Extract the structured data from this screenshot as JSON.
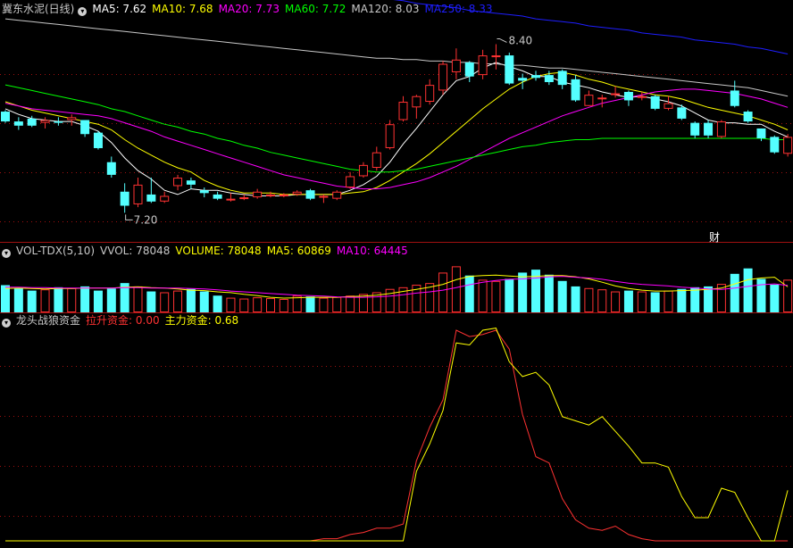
{
  "colors": {
    "background": "#000000",
    "up": "#ff3232",
    "down": "#54ffff",
    "ma5": "#ffffff",
    "ma10": "#ffff00",
    "ma20": "#ff00ff",
    "ma60": "#00ff00",
    "ma120": "#c8c8c8",
    "ma250": "#1e1eff",
    "grid": "#a01010",
    "text": "#c8c8c8"
  },
  "price_panel": {
    "title": "冀东水泥(日线)",
    "indicators": [
      {
        "label": "MA5: 7.62",
        "color": "#ffffff"
      },
      {
        "label": "MA10: 7.68",
        "color": "#ffff00"
      },
      {
        "label": "MA20: 7.73",
        "color": "#ff00ff"
      },
      {
        "label": "MA60: 7.72",
        "color": "#00ff00"
      },
      {
        "label": "MA120: 8.03",
        "color": "#c8c8c8"
      },
      {
        "label": "MA250: 8.33",
        "color": "#1e1eff"
      }
    ],
    "high_label": "8.40",
    "low_label": "7.20",
    "event_marker": "财"
  },
  "volume_panel": {
    "title": "VOL-TDX(5,10)",
    "indicators": [
      {
        "label": "VVOL: 78048",
        "color": "#c8c8c8"
      },
      {
        "label": "VOLUME: 78048",
        "color": "#ffff00"
      },
      {
        "label": "MA5: 60869",
        "color": "#ffff00"
      },
      {
        "label": "MA10: 64445",
        "color": "#ff00ff"
      }
    ]
  },
  "indicator_panel": {
    "title": "龙头战狼资金",
    "indicators": [
      {
        "label": "拉升资金: 0.00",
        "color": "#ff3232"
      },
      {
        "label": "主力资金: 0.68",
        "color": "#ffff00"
      }
    ]
  },
  "chart_data": [
    {
      "type": "candlestick",
      "title": "冀东水泥(日线)",
      "ylim": [
        7.05,
        8.6
      ],
      "candles": [
        [
          7.92,
          7.85,
          7.93,
          7.84
        ],
        [
          7.85,
          7.82,
          7.88,
          7.79
        ],
        [
          7.87,
          7.82,
          7.89,
          7.81
        ],
        [
          7.84,
          7.86,
          7.88,
          7.8
        ],
        [
          7.85,
          7.84,
          7.88,
          7.82
        ],
        [
          7.86,
          7.88,
          7.9,
          7.82
        ],
        [
          7.86,
          7.76,
          7.86,
          7.74
        ],
        [
          7.77,
          7.66,
          7.78,
          7.65
        ],
        [
          7.56,
          7.47,
          7.6,
          7.45
        ],
        [
          7.35,
          7.25,
          7.41,
          7.2
        ],
        [
          7.26,
          7.4,
          7.45,
          7.24
        ],
        [
          7.33,
          7.28,
          7.45,
          7.27
        ],
        [
          7.28,
          7.32,
          7.35,
          7.27
        ],
        [
          7.39,
          7.45,
          7.47,
          7.36
        ],
        [
          7.43,
          7.4,
          7.45,
          7.37
        ],
        [
          7.36,
          7.34,
          7.38,
          7.31
        ],
        [
          7.33,
          7.3,
          7.35,
          7.29
        ],
        [
          7.3,
          7.3,
          7.34,
          7.28
        ],
        [
          7.3,
          7.31,
          7.33,
          7.29
        ],
        [
          7.31,
          7.35,
          7.37,
          7.3
        ],
        [
          7.33,
          7.33,
          7.35,
          7.31
        ],
        [
          7.33,
          7.33,
          7.34,
          7.31
        ],
        [
          7.33,
          7.35,
          7.36,
          7.32
        ],
        [
          7.36,
          7.3,
          7.37,
          7.29
        ],
        [
          7.31,
          7.32,
          7.33,
          7.27
        ],
        [
          7.3,
          7.35,
          7.36,
          7.29
        ],
        [
          7.38,
          7.46,
          7.49,
          7.37
        ],
        [
          7.46,
          7.54,
          7.56,
          7.45
        ],
        [
          7.52,
          7.63,
          7.67,
          7.5
        ],
        [
          7.66,
          7.83,
          7.86,
          7.65
        ],
        [
          7.86,
          7.99,
          8.03,
          7.85
        ],
        [
          7.95,
          8.03,
          8.04,
          7.87
        ],
        [
          7.99,
          8.11,
          8.15,
          7.97
        ],
        [
          8.07,
          8.26,
          8.28,
          8.04
        ],
        [
          8.2,
          8.29,
          8.37,
          8.15
        ],
        [
          8.27,
          8.17,
          8.28,
          8.13
        ],
        [
          8.18,
          8.32,
          8.36,
          8.15
        ],
        [
          8.31,
          8.32,
          8.4,
          8.22
        ],
        [
          8.32,
          8.12,
          8.34,
          8.11
        ],
        [
          8.16,
          8.14,
          8.19,
          8.08
        ],
        [
          8.18,
          8.16,
          8.21,
          8.14
        ],
        [
          8.18,
          8.13,
          8.21,
          8.11
        ],
        [
          8.21,
          8.11,
          8.22,
          8.08
        ],
        [
          8.15,
          8.0,
          8.18,
          7.99
        ],
        [
          7.96,
          8.04,
          8.07,
          7.96
        ],
        [
          8.01,
          8.02,
          8.04,
          7.95
        ],
        [
          8.04,
          8.05,
          8.1,
          8.02
        ],
        [
          8.06,
          8.0,
          8.07,
          7.96
        ],
        [
          8.02,
          8.03,
          8.06,
          8.0
        ],
        [
          8.03,
          7.94,
          8.04,
          7.93
        ],
        [
          7.94,
          7.98,
          8.03,
          7.93
        ],
        [
          7.95,
          7.87,
          7.97,
          7.86
        ],
        [
          7.84,
          7.75,
          7.85,
          7.73
        ],
        [
          7.84,
          7.75,
          7.86,
          7.73
        ],
        [
          7.74,
          7.85,
          7.86,
          7.73
        ],
        [
          8.07,
          7.96,
          8.14,
          7.95
        ],
        [
          7.92,
          7.85,
          7.93,
          7.84
        ],
        [
          7.8,
          7.73,
          7.8,
          7.71
        ],
        [
          7.74,
          7.63,
          7.75,
          7.62
        ],
        [
          7.62,
          7.74,
          7.76,
          7.6
        ]
      ],
      "series": [
        {
          "name": "MA5",
          "values": [
            7.94,
            7.9,
            7.87,
            7.86,
            7.85,
            7.85,
            7.82,
            7.78,
            7.7,
            7.59,
            7.5,
            7.44,
            7.36,
            7.33,
            7.37,
            7.36,
            7.36,
            7.34,
            7.33,
            7.32,
            7.32,
            7.32,
            7.33,
            7.33,
            7.33,
            7.33,
            7.36,
            7.4,
            7.46,
            7.56,
            7.69,
            7.8,
            7.92,
            8.04,
            8.14,
            8.17,
            8.23,
            8.27,
            8.24,
            8.21,
            8.17,
            8.17,
            8.13,
            8.11,
            8.09,
            8.06,
            8.04,
            8.02,
            8.03,
            8.01,
            7.99,
            7.96,
            7.91,
            7.86,
            7.84,
            7.84,
            7.83,
            7.83,
            7.78,
            7.74
          ]
        },
        {
          "name": "MA10",
          "values": [
            7.99,
            7.96,
            7.93,
            7.91,
            7.89,
            7.87,
            7.85,
            7.83,
            7.79,
            7.72,
            7.66,
            7.61,
            7.56,
            7.52,
            7.49,
            7.43,
            7.39,
            7.36,
            7.34,
            7.34,
            7.34,
            7.33,
            7.33,
            7.33,
            7.33,
            7.33,
            7.34,
            7.35,
            7.38,
            7.43,
            7.49,
            7.55,
            7.62,
            7.7,
            7.78,
            7.86,
            7.94,
            8.01,
            8.08,
            8.13,
            8.17,
            8.19,
            8.2,
            8.18,
            8.15,
            8.13,
            8.1,
            8.08,
            8.06,
            8.04,
            8.03,
            8.01,
            7.98,
            7.95,
            7.93,
            7.91,
            7.89,
            7.86,
            7.83,
            7.79
          ]
        },
        {
          "name": "MA20",
          "values": [
            7.98,
            7.96,
            7.94,
            7.93,
            7.92,
            7.91,
            7.9,
            7.89,
            7.87,
            7.84,
            7.81,
            7.78,
            7.74,
            7.71,
            7.68,
            7.65,
            7.62,
            7.59,
            7.56,
            7.53,
            7.5,
            7.47,
            7.45,
            7.43,
            7.41,
            7.39,
            7.38,
            7.37,
            7.37,
            7.38,
            7.4,
            7.42,
            7.45,
            7.49,
            7.53,
            7.58,
            7.63,
            7.68,
            7.73,
            7.77,
            7.81,
            7.85,
            7.89,
            7.92,
            7.95,
            7.98,
            8.0,
            8.02,
            8.04,
            8.06,
            8.07,
            8.08,
            8.08,
            8.07,
            8.06,
            8.05,
            8.03,
            8.01,
            7.98,
            7.95
          ]
        },
        {
          "name": "MA60",
          "values": [
            8.11,
            8.09,
            8.07,
            8.05,
            8.03,
            8.01,
            7.99,
            7.97,
            7.94,
            7.92,
            7.89,
            7.86,
            7.83,
            7.81,
            7.78,
            7.76,
            7.73,
            7.71,
            7.68,
            7.66,
            7.63,
            7.61,
            7.59,
            7.57,
            7.55,
            7.53,
            7.51,
            7.5,
            7.49,
            7.49,
            7.5,
            7.51,
            7.53,
            7.55,
            7.57,
            7.59,
            7.61,
            7.63,
            7.65,
            7.67,
            7.68,
            7.7,
            7.71,
            7.72,
            7.72,
            7.73,
            7.73,
            7.73,
            7.73,
            7.73,
            7.73,
            7.73,
            7.73,
            7.73,
            7.73,
            7.73,
            7.73,
            7.73,
            7.72,
            7.72
          ]
        },
        {
          "name": "MA120",
          "values": [
            8.58,
            8.57,
            8.56,
            8.55,
            8.54,
            8.53,
            8.52,
            8.51,
            8.5,
            8.49,
            8.48,
            8.47,
            8.46,
            8.45,
            8.44,
            8.43,
            8.42,
            8.41,
            8.4,
            8.39,
            8.38,
            8.37,
            8.36,
            8.35,
            8.34,
            8.33,
            8.32,
            8.31,
            8.3,
            8.3,
            8.29,
            8.29,
            8.28,
            8.28,
            8.27,
            8.27,
            8.26,
            8.26,
            8.25,
            8.25,
            8.24,
            8.23,
            8.23,
            8.22,
            8.21,
            8.2,
            8.19,
            8.18,
            8.17,
            8.16,
            8.15,
            8.14,
            8.13,
            8.12,
            8.11,
            8.1,
            8.09,
            8.07,
            8.05,
            8.03
          ]
        },
        {
          "name": "MA250",
          "values": [
            9.05,
            9.04,
            9.03,
            9.02,
            9.01,
            9.0,
            8.99,
            8.98,
            8.97,
            8.96,
            8.95,
            8.93,
            8.92,
            8.91,
            8.9,
            8.89,
            8.87,
            8.86,
            8.85,
            8.84,
            8.83,
            8.81,
            8.8,
            8.79,
            8.78,
            8.77,
            8.75,
            8.74,
            8.73,
            8.72,
            8.71,
            8.69,
            8.68,
            8.67,
            8.66,
            8.64,
            8.63,
            8.62,
            8.61,
            8.6,
            8.58,
            8.57,
            8.56,
            8.55,
            8.53,
            8.52,
            8.51,
            8.5,
            8.48,
            8.47,
            8.46,
            8.45,
            8.43,
            8.42,
            8.41,
            8.4,
            8.38,
            8.37,
            8.35,
            8.33
          ]
        }
      ]
    },
    {
      "type": "bar",
      "title": "VOL-TDX(5,10)",
      "ylim": [
        0,
        130000
      ],
      "values": [
        65000,
        58000,
        52000,
        55000,
        60000,
        58000,
        62000,
        52000,
        57000,
        70000,
        62000,
        50000,
        48000,
        52000,
        56000,
        50000,
        40000,
        35000,
        33000,
        36000,
        34000,
        32000,
        40000,
        38000,
        35000,
        37000,
        40000,
        44000,
        48000,
        56000,
        60000,
        66000,
        70000,
        95000,
        110000,
        88000,
        78000,
        75000,
        80000,
        95000,
        102000,
        90000,
        75000,
        62000,
        58000,
        55000,
        50000,
        52000,
        50000,
        48000,
        52000,
        56000,
        60000,
        62000,
        68000,
        92000,
        105000,
        80000,
        66000,
        78048
      ],
      "series": [
        {
          "name": "MA5",
          "values": [
            57000,
            58000,
            57000,
            56000,
            57000,
            57000,
            58000,
            58000,
            58000,
            60000,
            61000,
            59000,
            58000,
            56000,
            53000,
            52000,
            49000,
            47000,
            43000,
            40000,
            36000,
            34000,
            35000,
            36000,
            36000,
            36000,
            38000,
            39000,
            41000,
            45000,
            50000,
            55000,
            60000,
            67000,
            78000,
            86000,
            88000,
            89000,
            87000,
            85000,
            86000,
            88000,
            88000,
            85000,
            80000,
            72000,
            63000,
            57000,
            53000,
            51000,
            51000,
            52000,
            53000,
            55000,
            58000,
            68000,
            78000,
            82000,
            84000,
            60869
          ]
        },
        {
          "name": "MA10",
          "values": [
            60000,
            60000,
            59000,
            59000,
            58000,
            58000,
            58000,
            58000,
            58000,
            59000,
            59000,
            58000,
            58000,
            58000,
            57000,
            56000,
            54000,
            51000,
            49000,
            47000,
            45000,
            43000,
            41000,
            40000,
            39000,
            37000,
            36000,
            36000,
            37000,
            39000,
            42000,
            46000,
            49000,
            53000,
            59000,
            66000,
            72000,
            76000,
            79000,
            80000,
            82000,
            85000,
            86000,
            84000,
            82000,
            79000,
            74000,
            70000,
            67000,
            65000,
            63000,
            60000,
            58000,
            56000,
            55000,
            58000,
            62000,
            66000,
            68000,
            64445
          ]
        }
      ]
    },
    {
      "type": "line",
      "title": "龙头战狼资金",
      "ylim": [
        0,
        1.0
      ],
      "series": [
        {
          "name": "拉升资金",
          "values": [
            0,
            0,
            0,
            0,
            0,
            0,
            0,
            0,
            0,
            0,
            0,
            0,
            0,
            0,
            0,
            0,
            0,
            0,
            0,
            0,
            0,
            0,
            0,
            0,
            0.01,
            0.01,
            0.03,
            0.04,
            0.06,
            0.06,
            0.08,
            0.38,
            0.54,
            0.67,
            1.0,
            0.97,
            0.98,
            1.0,
            0.91,
            0.6,
            0.4,
            0.37,
            0.2,
            0.1,
            0.06,
            0.05,
            0.07,
            0.03,
            0.01,
            0,
            0,
            0,
            0,
            0,
            0,
            0,
            0,
            0,
            0,
            0
          ]
        },
        {
          "name": "主力资金",
          "values": [
            0,
            0,
            0,
            0,
            0,
            0,
            0,
            0,
            0,
            0,
            0,
            0,
            0,
            0,
            0,
            0,
            0,
            0,
            0,
            0,
            0,
            0,
            0,
            0,
            0,
            0,
            0,
            0,
            0,
            0,
            0,
            0.33,
            0.46,
            0.62,
            0.94,
            0.93,
            1.0,
            1.01,
            0.85,
            0.78,
            0.8,
            0.74,
            0.59,
            0.57,
            0.55,
            0.59,
            0.52,
            0.45,
            0.37,
            0.37,
            0.35,
            0.21,
            0.11,
            0.11,
            0.25,
            0.23,
            0.11,
            0,
            0,
            0.24
          ]
        }
      ]
    }
  ]
}
